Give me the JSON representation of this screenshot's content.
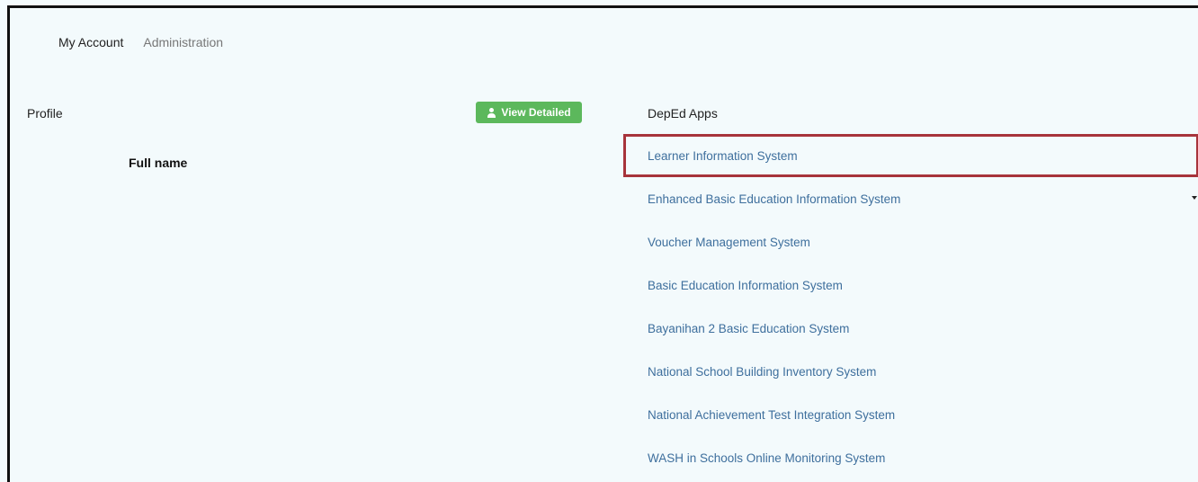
{
  "tabs": [
    {
      "label": "My Account"
    },
    {
      "label": "Administration"
    }
  ],
  "profile": {
    "label": "Profile",
    "view_button": "View Detailed",
    "fullname_label": "Full name"
  },
  "apps": {
    "title": "DepEd Apps",
    "items": [
      {
        "label": "Learner Information System"
      },
      {
        "label": "Enhanced Basic Education Information System"
      },
      {
        "label": "Voucher Management System"
      },
      {
        "label": "Basic Education Information System"
      },
      {
        "label": "Bayanihan 2 Basic Education System"
      },
      {
        "label": "National School Building Inventory System"
      },
      {
        "label": "National Achievement Test Integration System"
      },
      {
        "label": "WASH in Schools Online Monitoring System"
      }
    ]
  },
  "colors": {
    "background": "#f3fafc",
    "link": "#3e6f9d",
    "button": "#5cb85c",
    "highlight_border": "#a7333b"
  },
  "icons": {
    "view_button_icon": "user-icon",
    "dropdown_icon": "caret-down-icon"
  }
}
